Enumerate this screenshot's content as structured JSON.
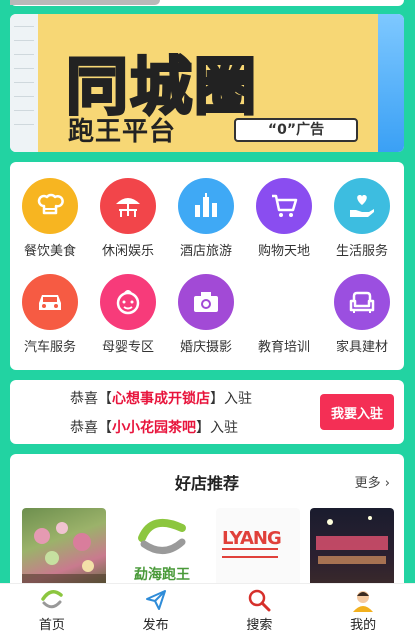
{
  "banner": {
    "title": "同城圈",
    "subtitle": "跑王平台",
    "tag": "“0”广告"
  },
  "categories": [
    {
      "label": "餐饮美食",
      "icon": "chef-hat-icon",
      "color": "#f7b521"
    },
    {
      "label": "休闲娱乐",
      "icon": "umbrella-table-icon",
      "color": "#f2454a"
    },
    {
      "label": "酒店旅游",
      "icon": "buildings-icon",
      "color": "#3fa9f5"
    },
    {
      "label": "购物天地",
      "icon": "cart-icon",
      "color": "#8a4df0"
    },
    {
      "label": "生活服务",
      "icon": "hand-heart-icon",
      "color": "#3dbde0"
    },
    {
      "label": "汽车服务",
      "icon": "car-icon",
      "color": "#f65b43"
    },
    {
      "label": "母婴专区",
      "icon": "baby-icon",
      "color": "#f73b7a"
    },
    {
      "label": "婚庆摄影",
      "icon": "camera-icon",
      "color": "#a24ad6"
    },
    {
      "label": "教育培训",
      "icon": "",
      "color": ""
    },
    {
      "label": "家具建材",
      "icon": "sofa-icon",
      "color": "#9b4fe0"
    }
  ],
  "notice": {
    "line1_prefix": "恭喜【",
    "line1_name": "心想事成开锁店",
    "line1_suffix": "】入驻",
    "line2_prefix": "恭喜【",
    "line2_name": "小小花园茶吧",
    "line2_suffix": "】入驻",
    "button": "我要入驻"
  },
  "recommend": {
    "title": "好店推荐",
    "more": "更多",
    "shops": [
      {
        "name": "flower-shop"
      },
      {
        "name": "勐海跑王"
      },
      {
        "name": "LYANG"
      },
      {
        "name": "night-shop"
      }
    ],
    "logo2_text": "勐海跑王",
    "logo3_text": "LYANG"
  },
  "nav": {
    "items": [
      {
        "label": "首页",
        "icon": "home-logo-icon"
      },
      {
        "label": "发布",
        "icon": "paper-plane-icon"
      },
      {
        "label": "搜索",
        "icon": "search-icon"
      },
      {
        "label": "我的",
        "icon": "user-avatar-icon"
      }
    ]
  }
}
